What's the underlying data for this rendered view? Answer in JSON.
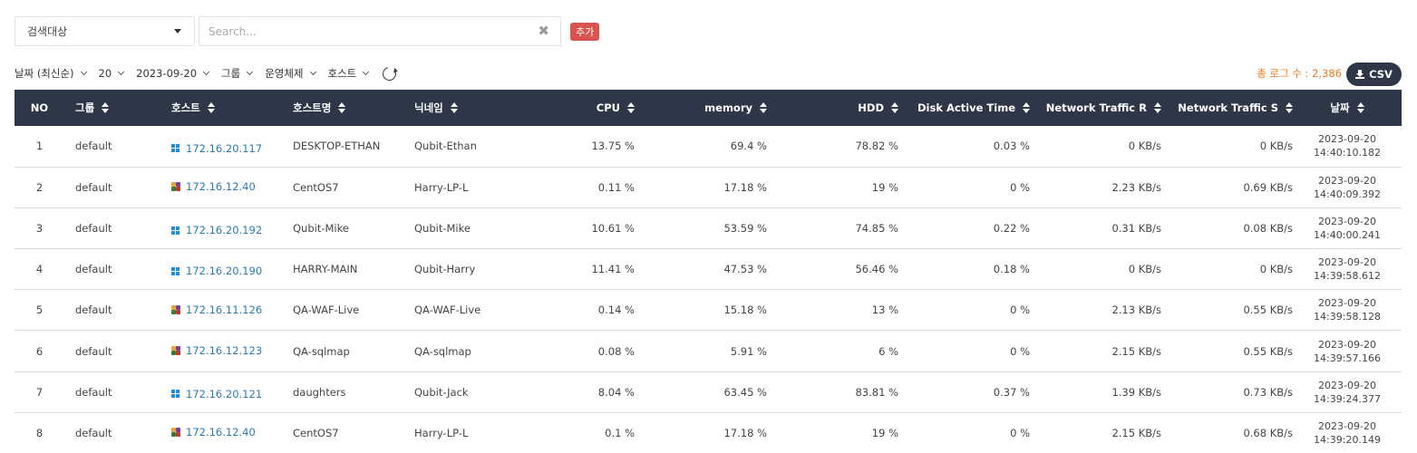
{
  "search": {
    "target_select": "검색대상",
    "placeholder": "Search...",
    "value": "",
    "add_label": "추가"
  },
  "filters": [
    {
      "label": "날짜 (최신순)"
    },
    {
      "label": "20"
    },
    {
      "label": "2023-09-20"
    },
    {
      "label": "그룹"
    },
    {
      "label": "운영체제"
    },
    {
      "label": "호스트"
    }
  ],
  "summary": {
    "total_label": "총 로그 수 : 2,386",
    "csv_label": "CSV"
  },
  "colors": {
    "header_bg": "#2d3748",
    "link": "#2a7ab0",
    "add_button": "#d9534f",
    "total_text": "#f07a1e",
    "windows_icon": "#1e8fd6"
  },
  "table": {
    "columns": [
      "NO",
      "그룹",
      "호스트",
      "호스트명",
      "닉네임",
      "CPU",
      "memory",
      "HDD",
      "Disk Active Time",
      "Network Traffic R",
      "Network Traffic S",
      "날짜"
    ],
    "rows": [
      {
        "no": "1",
        "group": "default",
        "os": "windows-icon",
        "host": "172.16.20.117",
        "hostname": "DESKTOP-ETHAN",
        "nickname": "Qubit-Ethan",
        "cpu": "13.75 %",
        "memory": "69.4 %",
        "hdd": "78.82 %",
        "disk": "0.03 %",
        "net_r": "0 KB/s",
        "net_s": "0 KB/s",
        "date": "2023-09-20",
        "time": "14:40:10.182"
      },
      {
        "no": "2",
        "group": "default",
        "os": "linux-icon",
        "host": "172.16.12.40",
        "hostname": "CentOS7",
        "nickname": "Harry-LP-L",
        "cpu": "0.11 %",
        "memory": "17.18 %",
        "hdd": "19 %",
        "disk": "0 %",
        "net_r": "2.23 KB/s",
        "net_s": "0.69 KB/s",
        "date": "2023-09-20",
        "time": "14:40:09.392"
      },
      {
        "no": "3",
        "group": "default",
        "os": "windows-icon",
        "host": "172.16.20.192",
        "hostname": "Qubit-Mike",
        "nickname": "Qubit-Mike",
        "cpu": "10.61 %",
        "memory": "53.59 %",
        "hdd": "74.85 %",
        "disk": "0.22 %",
        "net_r": "0.31 KB/s",
        "net_s": "0.08 KB/s",
        "date": "2023-09-20",
        "time": "14:40:00.241"
      },
      {
        "no": "4",
        "group": "default",
        "os": "windows-icon",
        "host": "172.16.20.190",
        "hostname": "HARRY-MAIN",
        "nickname": "Qubit-Harry",
        "cpu": "11.41 %",
        "memory": "47.53 %",
        "hdd": "56.46 %",
        "disk": "0.18 %",
        "net_r": "0 KB/s",
        "net_s": "0 KB/s",
        "date": "2023-09-20",
        "time": "14:39:58.612"
      },
      {
        "no": "5",
        "group": "default",
        "os": "linux-icon",
        "host": "172.16.11.126",
        "hostname": "QA-WAF-Live",
        "nickname": "QA-WAF-Live",
        "cpu": "0.14 %",
        "memory": "15.18 %",
        "hdd": "13 %",
        "disk": "0 %",
        "net_r": "2.13 KB/s",
        "net_s": "0.55 KB/s",
        "date": "2023-09-20",
        "time": "14:39:58.128"
      },
      {
        "no": "6",
        "group": "default",
        "os": "linux-icon",
        "host": "172.16.12.123",
        "hostname": "QA-sqlmap",
        "nickname": "QA-sqlmap",
        "cpu": "0.08 %",
        "memory": "5.91 %",
        "hdd": "6 %",
        "disk": "0 %",
        "net_r": "2.15 KB/s",
        "net_s": "0.55 KB/s",
        "date": "2023-09-20",
        "time": "14:39:57.166"
      },
      {
        "no": "7",
        "group": "default",
        "os": "windows-icon",
        "host": "172.16.20.121",
        "hostname": "daughters",
        "nickname": "Qubit-Jack",
        "cpu": "8.04 %",
        "memory": "63.45 %",
        "hdd": "83.81 %",
        "disk": "0.37 %",
        "net_r": "1.39 KB/s",
        "net_s": "0.73 KB/s",
        "date": "2023-09-20",
        "time": "14:39:24.377"
      },
      {
        "no": "8",
        "group": "default",
        "os": "linux-icon",
        "host": "172.16.12.40",
        "hostname": "CentOS7",
        "nickname": "Harry-LP-L",
        "cpu": "0.1 %",
        "memory": "17.18 %",
        "hdd": "19 %",
        "disk": "0 %",
        "net_r": "2.15 KB/s",
        "net_s": "0.68 KB/s",
        "date": "2023-09-20",
        "time": "14:39:20.149"
      }
    ]
  }
}
